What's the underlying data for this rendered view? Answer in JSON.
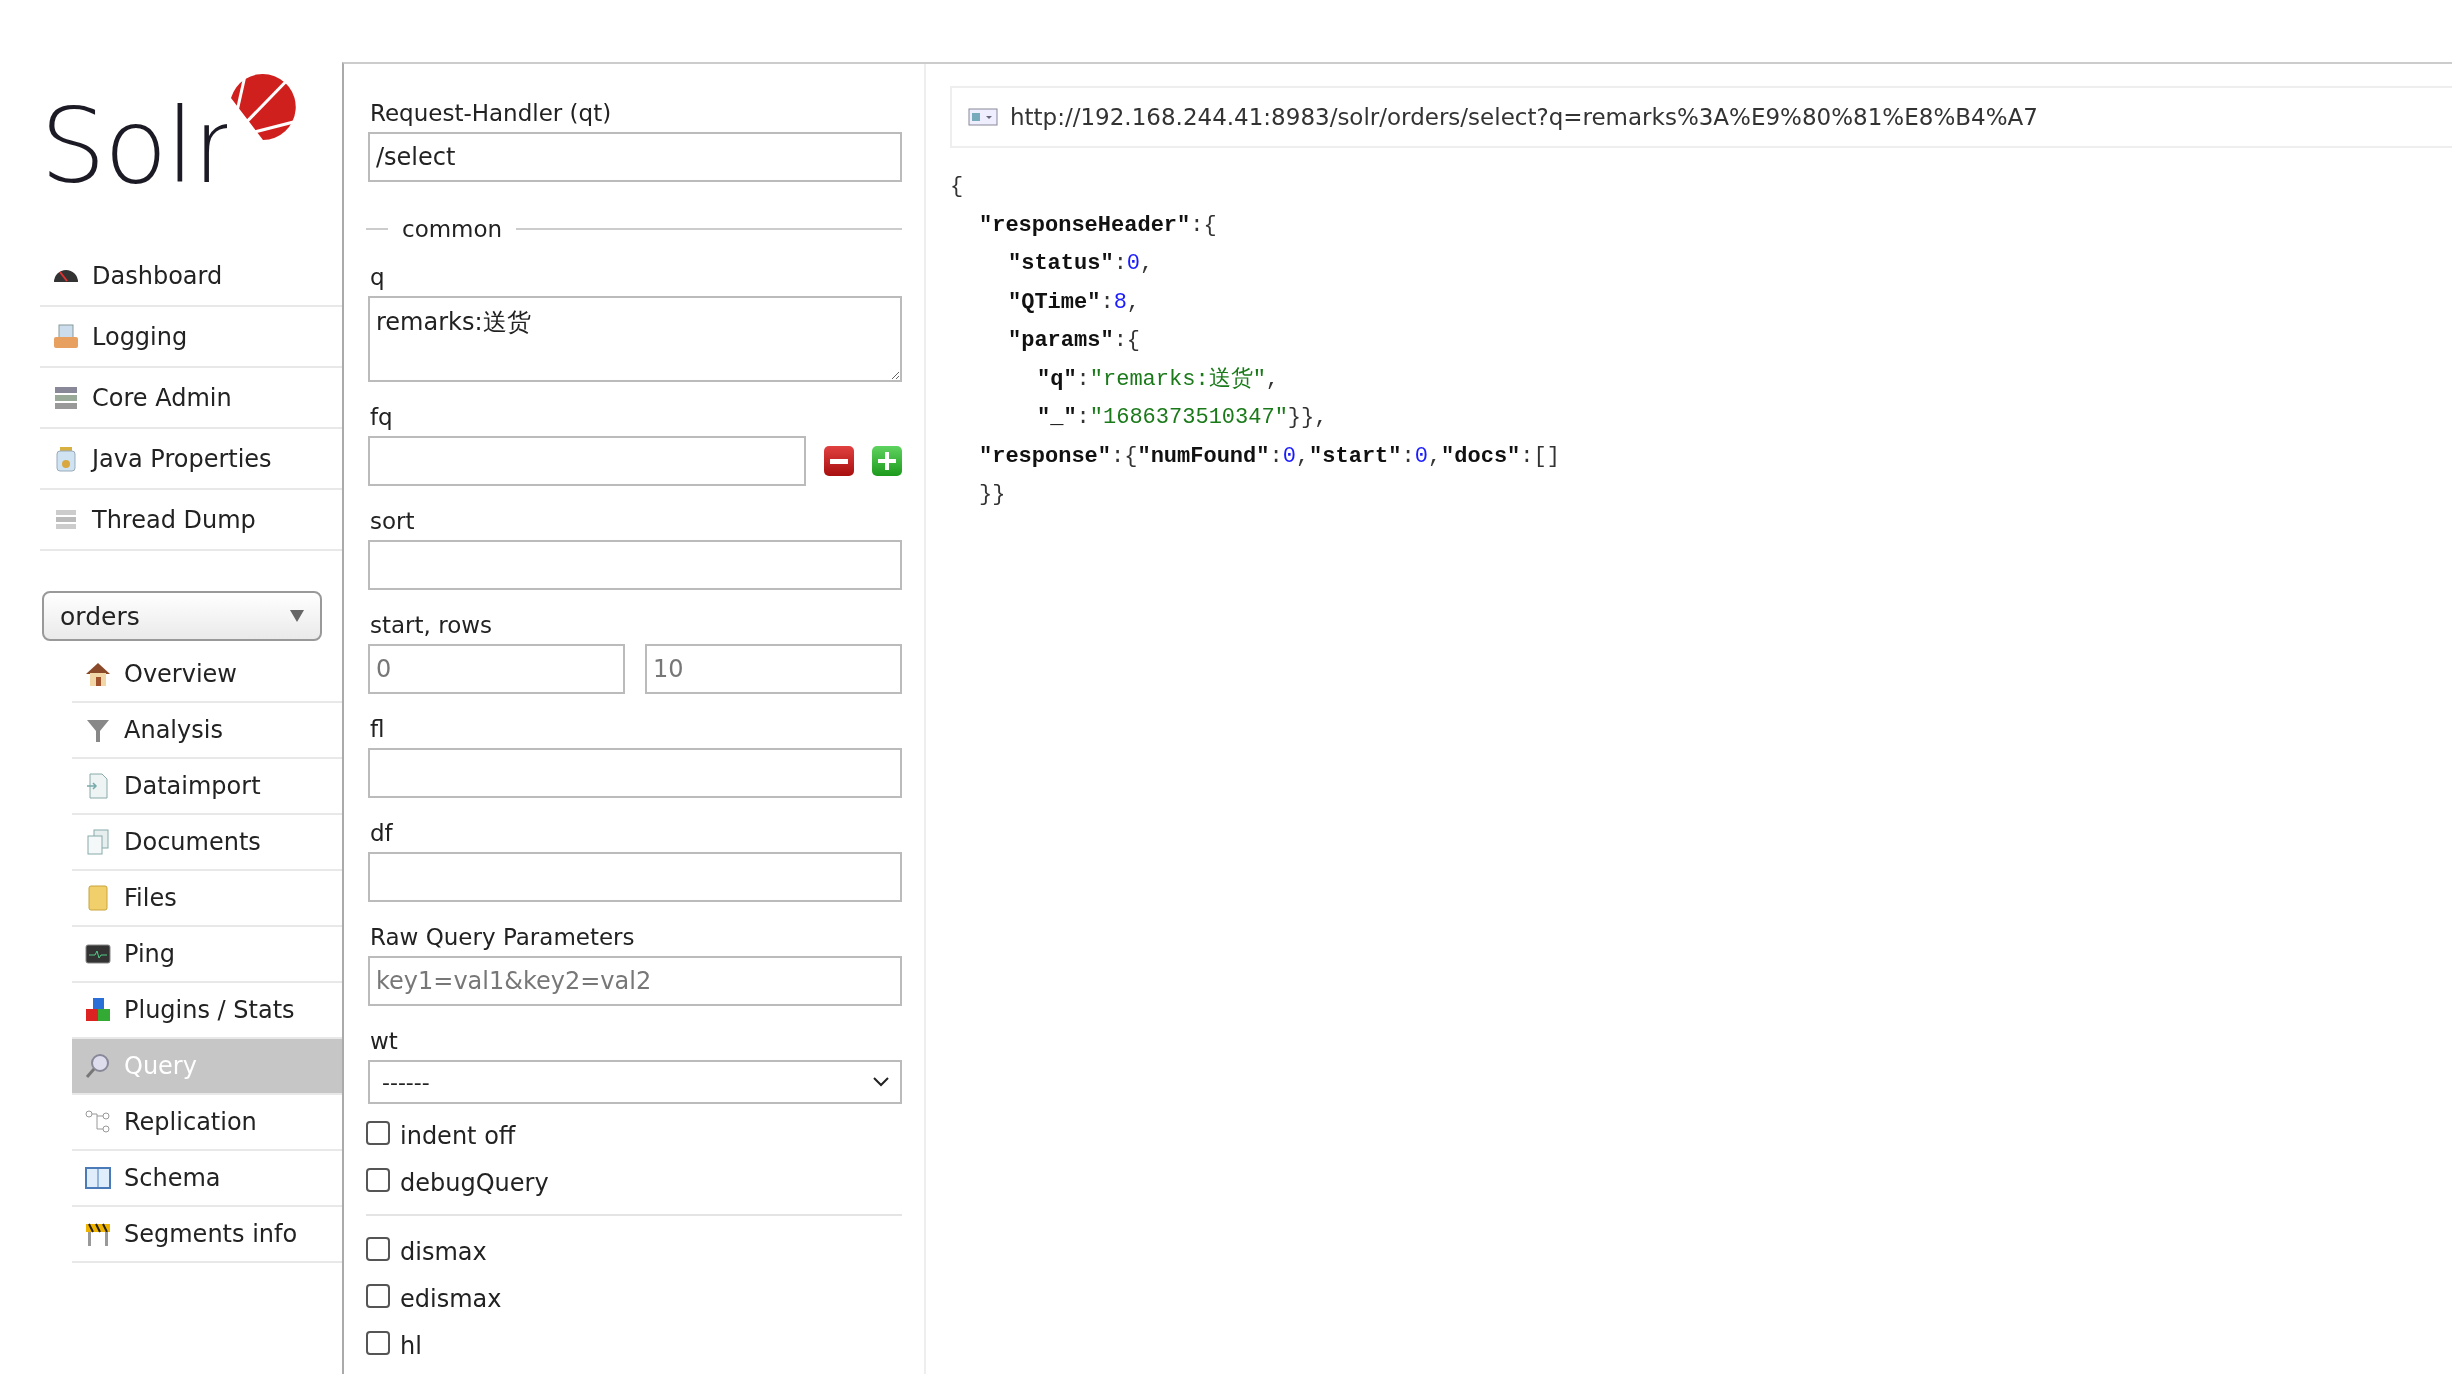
{
  "logo": {
    "text": "Solr"
  },
  "nav": {
    "items": [
      {
        "label": "Dashboard",
        "selected": false
      },
      {
        "label": "Logging",
        "selected": false
      },
      {
        "label": "Core Admin",
        "selected": false
      },
      {
        "label": "Java Properties",
        "selected": false
      },
      {
        "label": "Thread Dump",
        "selected": false
      }
    ]
  },
  "core_selector": {
    "value": "orders"
  },
  "core_nav": {
    "items": [
      {
        "label": "Overview",
        "selected": false
      },
      {
        "label": "Analysis",
        "selected": false
      },
      {
        "label": "Dataimport",
        "selected": false
      },
      {
        "label": "Documents",
        "selected": false
      },
      {
        "label": "Files",
        "selected": false
      },
      {
        "label": "Ping",
        "selected": false
      },
      {
        "label": "Plugins / Stats",
        "selected": false
      },
      {
        "label": "Query",
        "selected": true
      },
      {
        "label": "Replication",
        "selected": false
      },
      {
        "label": "Schema",
        "selected": false
      },
      {
        "label": "Segments info",
        "selected": false
      }
    ]
  },
  "form": {
    "handler": {
      "label": "Request-Handler (qt)",
      "value": "/select"
    },
    "section": "common",
    "fields": [
      {
        "kind": "textarea",
        "label": "q",
        "value": "remarks:送货"
      },
      {
        "kind": "multi",
        "label": "fq"
      },
      {
        "kind": "text",
        "label": "sort"
      },
      {
        "kind": "pair",
        "label": "start, rows",
        "placeholders": [
          "0",
          "10"
        ]
      },
      {
        "kind": "text",
        "label": "fl"
      },
      {
        "kind": "text",
        "label": "df"
      },
      {
        "kind": "text",
        "label": "Raw Query Parameters",
        "placeholder": "key1=val1&key2=val2"
      },
      {
        "kind": "select",
        "label": "wt",
        "value": "------"
      }
    ],
    "options": [
      {
        "label": "indent off",
        "checked": false
      },
      {
        "label": "debugQuery",
        "checked": false
      }
    ],
    "parsers": [
      {
        "label": "dismax",
        "checked": false
      },
      {
        "label": "edismax",
        "checked": false
      },
      {
        "label": "hl",
        "checked": false
      }
    ]
  },
  "result": {
    "url": "http://192.168.244.41:8983/solr/orders/select?q=remarks%3A%E9%80%81%E8%B4%A7",
    "lines": [
      {
        "tokens": [
          {
            "kind": "punct",
            "text": "{"
          }
        ],
        "children": [
          {
            "tokens": [
              {
                "kind": "key",
                "text": "\"responseHeader\""
              },
              {
                "kind": "punct",
                "text": ":{"
              }
            ],
            "children": [
              {
                "tokens": [
                  {
                    "kind": "key",
                    "text": "\"status\""
                  },
                  {
                    "kind": "punct",
                    "text": ":"
                  },
                  {
                    "kind": "number",
                    "text": "0"
                  },
                  {
                    "kind": "punct",
                    "text": ","
                  }
                ]
              },
              {
                "tokens": [
                  {
                    "kind": "key",
                    "text": "\"QTime\""
                  },
                  {
                    "kind": "punct",
                    "text": ":"
                  },
                  {
                    "kind": "number",
                    "text": "8"
                  },
                  {
                    "kind": "punct",
                    "text": ","
                  }
                ]
              },
              {
                "tokens": [
                  {
                    "kind": "key",
                    "text": "\"params\""
                  },
                  {
                    "kind": "punct",
                    "text": ":{"
                  }
                ],
                "children": [
                  {
                    "tokens": [
                      {
                        "kind": "key",
                        "text": "\"q\""
                      },
                      {
                        "kind": "punct",
                        "text": ":"
                      },
                      {
                        "kind": "string",
                        "text": "\"remarks:送货\""
                      },
                      {
                        "kind": "punct",
                        "text": ","
                      }
                    ]
                  },
                  {
                    "tokens": [
                      {
                        "kind": "key",
                        "text": "\"_\""
                      },
                      {
                        "kind": "punct",
                        "text": ":"
                      },
                      {
                        "kind": "string",
                        "text": "\"1686373510347\""
                      },
                      {
                        "kind": "punct",
                        "text": "}},"
                      }
                    ]
                  }
                ]
              }
            ]
          },
          {
            "tokens": [
              {
                "kind": "key",
                "text": "\"response\""
              },
              {
                "kind": "punct",
                "text": ":{"
              },
              {
                "kind": "key",
                "text": "\"numFound\""
              },
              {
                "kind": "punct",
                "text": ":"
              },
              {
                "kind": "number",
                "text": "0"
              },
              {
                "kind": "punct",
                "text": ","
              },
              {
                "kind": "key",
                "text": "\"start\""
              },
              {
                "kind": "punct",
                "text": ":"
              },
              {
                "kind": "number",
                "text": "0"
              },
              {
                "kind": "punct",
                "text": ","
              },
              {
                "kind": "key",
                "text": "\"docs\""
              },
              {
                "kind": "punct",
                "text": ":[]"
              }
            ]
          },
          {
            "tokens": [
              {
                "kind": "punct",
                "text": "}}"
              }
            ]
          }
        ]
      }
    ]
  }
}
